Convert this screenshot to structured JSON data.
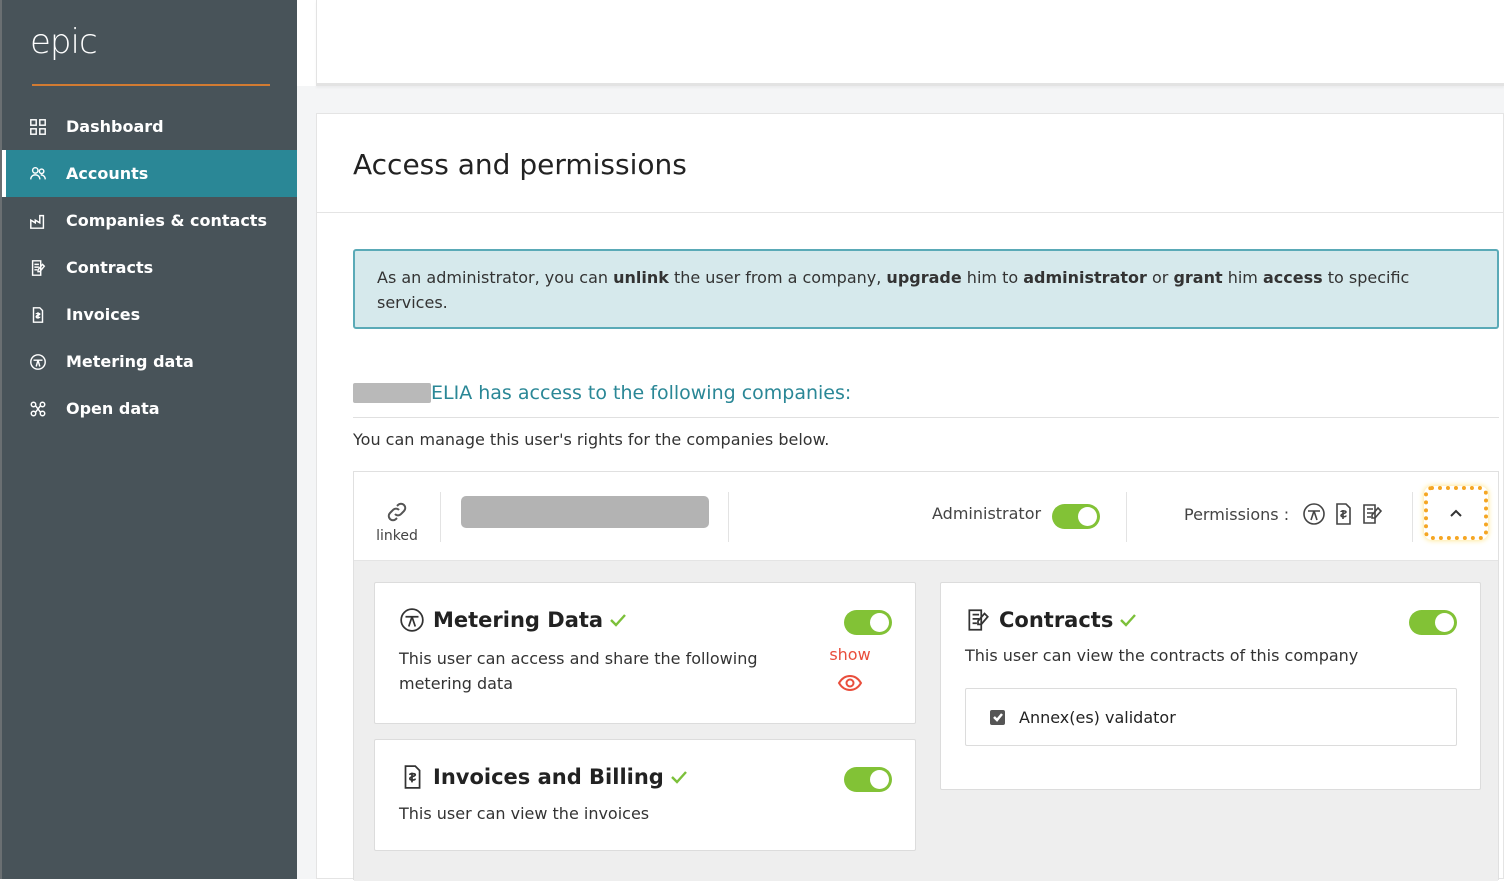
{
  "brand": {
    "logo_text": "epic",
    "accent": "#e8862a"
  },
  "sidebar": {
    "items": [
      {
        "label": "Dashboard",
        "icon": "grid-icon"
      },
      {
        "label": "Accounts",
        "icon": "users-icon",
        "active": true
      },
      {
        "label": "Companies & contacts",
        "icon": "factory-icon"
      },
      {
        "label": "Contracts",
        "icon": "contract-icon"
      },
      {
        "label": "Invoices",
        "icon": "invoice-icon"
      },
      {
        "label": "Metering data",
        "icon": "meter-icon"
      },
      {
        "label": "Open data",
        "icon": "network-icon"
      }
    ]
  },
  "page": {
    "title": "Access and permissions",
    "info": {
      "p1": "As an administrator, you can ",
      "b1": "unlink",
      "p2": " the user from a company, ",
      "b2": "upgrade",
      "p3": " him to ",
      "b3": "administrator",
      "p4": " or ",
      "b4": "grant",
      "p5": " him ",
      "b5": "access",
      "p6": " to specific services."
    },
    "companies_title": "ELIA has access to the following companies:",
    "companies_subtitle": "You can manage this user's rights for the companies below."
  },
  "company": {
    "linked_label": "linked",
    "administrator_label": "Administrator",
    "administrator_on": true,
    "permissions_label": "Permissions :",
    "permission_icons": [
      "meter-icon",
      "invoice-icon",
      "contract-icon"
    ]
  },
  "services": {
    "metering": {
      "title": "Metering Data",
      "description": "This user can access and share the following metering data",
      "show_label": "show",
      "enabled": true
    },
    "invoices": {
      "title": "Invoices and Billing",
      "description": "This user can view the invoices",
      "enabled": true
    },
    "contracts": {
      "title": "Contracts",
      "description": "This user can view the contracts of this company",
      "enabled": true,
      "option_label": "Annex(es) validator",
      "option_checked": true
    }
  }
}
